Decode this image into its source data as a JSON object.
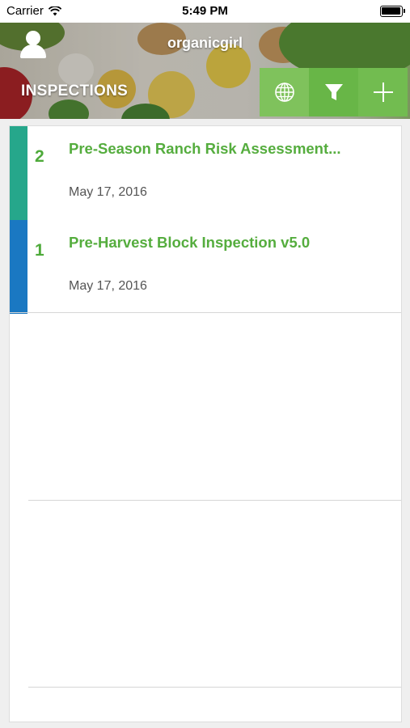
{
  "status_bar": {
    "carrier": "Carrier",
    "time": "5:49 PM",
    "wifi_icon": "wifi-icon",
    "battery_icon": "battery-icon"
  },
  "header": {
    "org_name": "organicgirl",
    "page_title": "INSPECTIONS",
    "avatar_icon": "user-avatar-icon",
    "actions": [
      {
        "icon": "globe-icon",
        "label": "globe"
      },
      {
        "icon": "filter-icon",
        "label": "filter"
      },
      {
        "icon": "plus-icon",
        "label": "add"
      }
    ]
  },
  "inspections": [
    {
      "number": "2",
      "title": "Pre-Season Ranch Risk Assessment...",
      "date": "May 17, 2016",
      "accent_color": "#26a78b"
    },
    {
      "number": "1",
      "title": "Pre-Harvest Block Inspection v5.0",
      "date": "May 17, 2016",
      "accent_color": "#1a78c2"
    }
  ],
  "colors": {
    "brand_green": "#55ad3e",
    "action_green": "#68b647"
  }
}
